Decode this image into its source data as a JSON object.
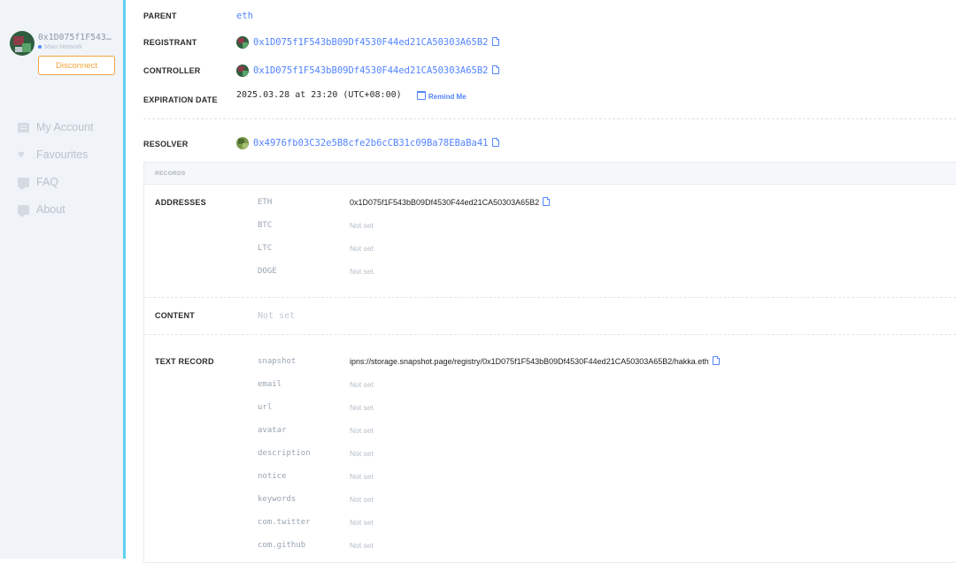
{
  "sidebar": {
    "address": "0x1D075f1F543…",
    "network": "Main Network",
    "disconnect_label": "Disconnect",
    "nav": [
      {
        "label": "My Account",
        "icon": "account-icon"
      },
      {
        "label": "Favourites",
        "icon": "heart-icon"
      },
      {
        "label": "FAQ",
        "icon": "chat-icon"
      },
      {
        "label": "About",
        "icon": "chat-icon"
      }
    ]
  },
  "details": {
    "parent_label": "PARENT",
    "parent_value": "eth",
    "registrant_label": "REGISTRANT",
    "registrant_value": "0x1D075f1F543bB09Df4530F44ed21CA50303A65B2",
    "controller_label": "CONTROLLER",
    "controller_value": "0x1D075f1F543bB09Df4530F44ed21CA50303A65B2",
    "expiration_label": "EXPIRATION DATE",
    "expiration_value": "2025.03.28 at 23:20 (UTC+08:00)",
    "remind_label": "Remind Me",
    "resolver_label": "RESOLVER",
    "resolver_value": "0x4976fb03C32e5B8cfe2b6cCB31c09Ba78EBaBa41"
  },
  "records": {
    "header": "RECORDS",
    "addresses_label": "ADDRESSES",
    "addresses": [
      {
        "key": "ETH",
        "value": "0x1D075f1F543bB09Df4530F44ed21CA50303A65B2"
      },
      {
        "key": "BTC",
        "value": "Not set"
      },
      {
        "key": "LTC",
        "value": "Not set"
      },
      {
        "key": "DOGE",
        "value": "Not set"
      }
    ],
    "content_label": "CONTENT",
    "content_value": "Not set",
    "text_label": "TEXT RECORD",
    "text": [
      {
        "key": "snapshot",
        "value": "ipns://storage.snapshot.page/registry/0x1D075f1F543bB09Df4530F44ed21CA50303A65B2/hakka.eth"
      },
      {
        "key": "email",
        "value": "Not set"
      },
      {
        "key": "url",
        "value": "Not set"
      },
      {
        "key": "avatar",
        "value": "Not set"
      },
      {
        "key": "description",
        "value": "Not set"
      },
      {
        "key": "notice",
        "value": "Not set"
      },
      {
        "key": "keywords",
        "value": "Not set"
      },
      {
        "key": "com.twitter",
        "value": "Not set"
      },
      {
        "key": "com.github",
        "value": "Not set"
      }
    ]
  },
  "colors": {
    "accent": "#5284ff",
    "disconnect": "#f2a43a",
    "sidebar_border": "#5fd0f0"
  }
}
